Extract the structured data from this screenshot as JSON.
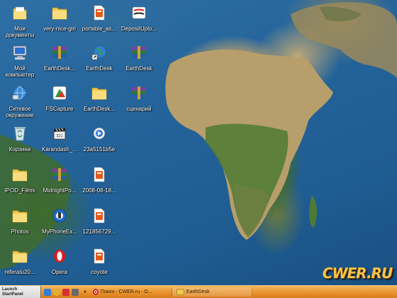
{
  "desktop": {
    "icons": [
      {
        "label": "Мои документы",
        "icon": "folder-icon"
      },
      {
        "label": "very-nice-girl",
        "icon": "folder-icon"
      },
      {
        "label": "portable_as...",
        "icon": "archive-file-icon"
      },
      {
        "label": "DepositUplo...",
        "icon": "app-icon"
      },
      {
        "label": "Мой компьютер",
        "icon": "computer-icon"
      },
      {
        "label": "EarthDesk...",
        "icon": "winrar-archive-icon"
      },
      {
        "label": "EarthDesk",
        "icon": "globe-shortcut-icon"
      },
      {
        "label": "EarthDesk",
        "icon": "winrar-archive-icon"
      },
      {
        "label": "Сетевое окружение",
        "icon": "network-icon"
      },
      {
        "label": "FSCapture",
        "icon": "capture-app-icon"
      },
      {
        "label": "EarthDesk...",
        "icon": "folder-icon"
      },
      {
        "label": "сценарий",
        "icon": "winrar-archive-icon"
      },
      {
        "label": "Корзина",
        "icon": "recycle-bin-icon"
      },
      {
        "label": "Karandash_...",
        "icon": "video-clapper-icon"
      },
      {
        "label": "23a5151b5e",
        "icon": "media-file-icon"
      },
      {
        "label": "IPOD_Films",
        "icon": "folder-icon"
      },
      {
        "label": "MidnightPo...",
        "icon": "winrar-archive-icon"
      },
      {
        "label": "2008-08-18...",
        "icon": "archive-file-icon"
      },
      {
        "label": "Photos",
        "icon": "folder-icon"
      },
      {
        "label": "MyPhoneEx...",
        "icon": "phone-app-icon"
      },
      {
        "label": "121856729...",
        "icon": "archive-file-icon"
      },
      {
        "label": "referatu20...",
        "icon": "folder-icon"
      },
      {
        "label": "Opera",
        "icon": "opera-icon"
      },
      {
        "label": "coyote",
        "icon": "archive-file-icon"
      }
    ]
  },
  "taskbar": {
    "start_line1": "Launch",
    "start_line2": "StartPanel",
    "chevron": "»",
    "tasks": [
      {
        "label": "Поиск - CWER.ru - О...",
        "icon": "opera-icon"
      },
      {
        "label": "EarthDesk",
        "icon": "folder-icon"
      }
    ]
  },
  "watermark": {
    "text": "CWER.RU"
  },
  "colors": {
    "ocean": "#23639a",
    "taskbar": "#e8912b",
    "folder": "#f5d36b",
    "label_text": "#ffffff"
  }
}
